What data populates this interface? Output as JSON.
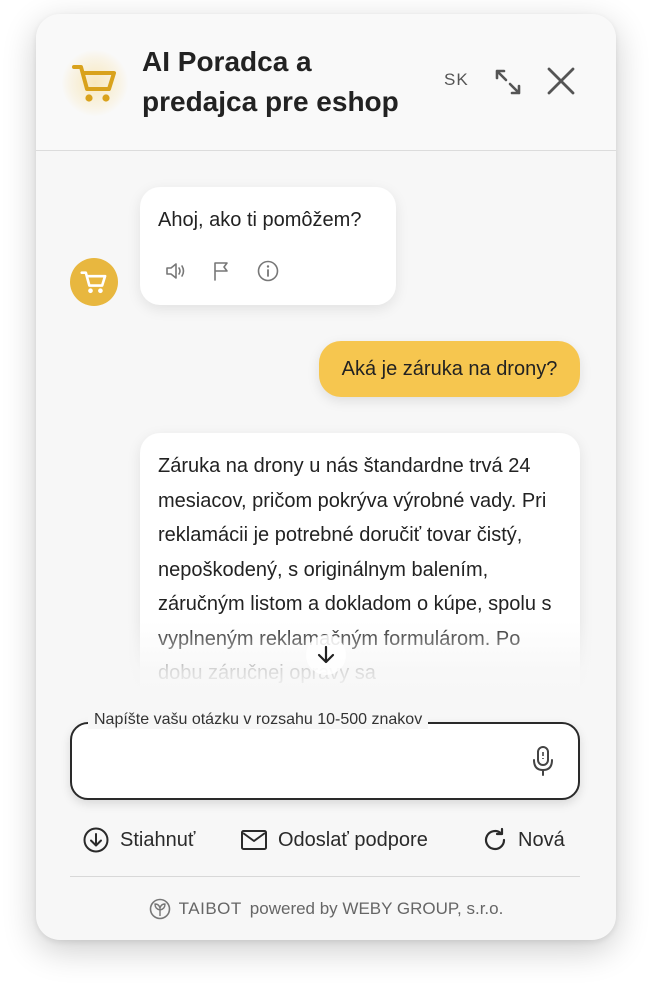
{
  "header": {
    "title": "AI Poradca a predajca pre eshop",
    "language": "SK",
    "icons": {
      "logo": "shopping-cart-icon",
      "expand": "expand-arrows-icon",
      "close": "close-icon"
    }
  },
  "messages": [
    {
      "role": "bot",
      "text": "Ahoj, ako ti pomôžem?",
      "actions": [
        "speaker-icon",
        "flag-icon",
        "info-icon"
      ]
    },
    {
      "role": "user",
      "text": "Aká je záruka na drony?"
    },
    {
      "role": "bot",
      "text": "Záruka na drony u nás štandardne trvá 24 mesiacov, pričom pokrýva výrobné vady. Pri reklamácii je potrebné doručiť tovar čistý, nepoškodený, s originálnym balením, záručným listom a dokladom o kúpe, spolu s vyplneným reklamačným formulárom. Po dobu záručnej opravy sa"
    }
  ],
  "input": {
    "label": "Napíšte vašu otázku v rozsahu 10-500 znakov",
    "value": "",
    "mic_icon": "microphone-icon"
  },
  "toolbar": {
    "download": "Stiahnuť",
    "support": "Odoslať podpore",
    "new": "Nová"
  },
  "footer": {
    "brand": "TAIBOT",
    "text": "powered by WEBY GROUP, s.r.o."
  },
  "colors": {
    "accent": "#f6c64f",
    "avatar": "#e8b73f",
    "background": "#f7f7f7",
    "text": "#222222"
  }
}
